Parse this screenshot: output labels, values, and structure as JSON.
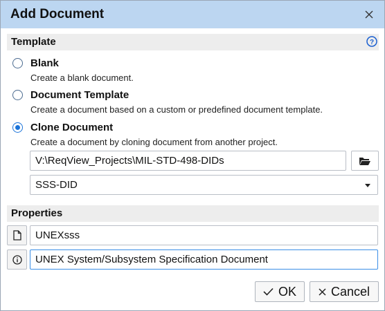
{
  "window": {
    "title": "Add Document",
    "close_icon": "close-icon"
  },
  "template_section": {
    "title": "Template",
    "help_icon": "help-icon",
    "options": [
      {
        "label": "Blank",
        "description": "Create a blank document.",
        "selected": false
      },
      {
        "label": "Document Template",
        "description": "Create a document based on a custom or predefined document template.",
        "selected": false
      },
      {
        "label": "Clone Document",
        "description": "Create a document by cloning document from another project.",
        "selected": true
      }
    ],
    "path_value": "V:\\ReqView_Projects\\MIL-STD-498-DIDs",
    "browse_icon": "folder-open-icon",
    "document_select": {
      "value": "SSS-DID"
    }
  },
  "properties_section": {
    "title": "Properties",
    "id_icon": "file-icon",
    "id_value": "UNEXsss",
    "description_icon": "info-icon",
    "description_value": "UNEX System/Subsystem Specification Document"
  },
  "footer": {
    "ok_label": "OK",
    "cancel_label": "Cancel"
  },
  "colors": {
    "titlebar": "#bcd6f1",
    "accent": "#1a73d9",
    "section_bg": "#ededed"
  }
}
